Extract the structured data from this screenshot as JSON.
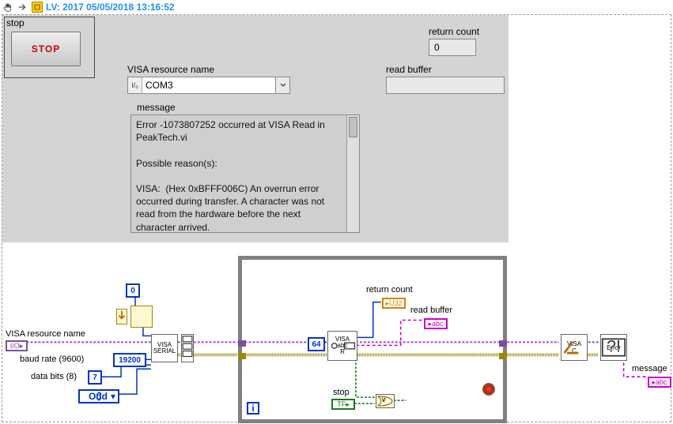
{
  "header": {
    "title": "LV: 2017 05/05/2018 13:16:52"
  },
  "front_panel": {
    "stop": {
      "frame_label": "stop",
      "button_label": "STOP"
    },
    "visa": {
      "label": "VISA resource name",
      "io_badge": "I/₀",
      "value": "COM3"
    },
    "return_count": {
      "label": "return count",
      "value": "0"
    },
    "read_buffer": {
      "label": "read buffer",
      "value": ""
    },
    "message": {
      "label": "message",
      "text": "Error -1073807252 occurred at VISA Read in PeakTech.vi\n\nPossible reason(s):\n\nVISA:  (Hex 0xBFFF006C) An overrun error occurred during transfer. A character was not read from the hardware before the next character arrived."
    }
  },
  "block_diagram": {
    "const_zero": "0",
    "visa_resource_label": "VISA resource name",
    "visa_serial_label": "VISA\nSERIAL",
    "baud_label": "baud rate (9600)",
    "baud_value": "19200",
    "databits_label": "data bits (8)",
    "databits_value": "7",
    "parity_value": "Odd",
    "bytes_to_read": "64",
    "visa_read_label": "VISA\nabc\nR",
    "visa_close_label": "VISA\nC",
    "return_count_label": "return count",
    "return_count_ind": "▸U32",
    "read_buffer_label": "read buffer",
    "read_buffer_ind": "▸abc",
    "stop_label": "stop",
    "stop_ctrl": "TF▸",
    "error_label": "Error",
    "message_label": "message",
    "message_ind": "▸abc",
    "visa_ctrl": "I/O▸",
    "loop_i": "i",
    "or_gate": "∨"
  }
}
